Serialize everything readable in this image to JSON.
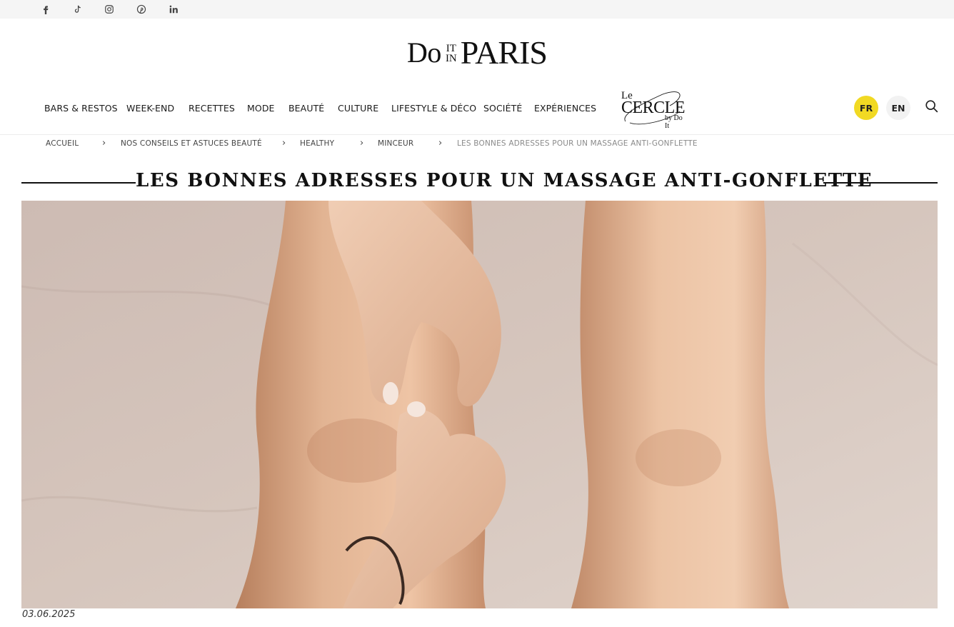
{
  "social": {
    "icons": [
      "facebook-icon",
      "tiktok-icon",
      "instagram-icon",
      "pinterest-icon",
      "linkedin-icon"
    ]
  },
  "logo": {
    "do": "Do",
    "it": "IT",
    "in": "IN",
    "paris": "PARIS"
  },
  "nav": {
    "items": [
      {
        "label": "BARS & RESTOS"
      },
      {
        "label": "WEEK-END"
      },
      {
        "label": "RECETTES"
      },
      {
        "label": "MODE"
      },
      {
        "label": "BEAUTÉ"
      },
      {
        "label": "CULTURE"
      },
      {
        "label": "LIFESTYLE & DÉCO"
      },
      {
        "label": "SOCIÉTÉ"
      },
      {
        "label": "EXPÉRIENCES"
      }
    ],
    "cercle": {
      "le": "Le",
      "cercle": "CERCLE",
      "by": "by Do It"
    },
    "languages": {
      "fr": "FR",
      "en": "EN"
    }
  },
  "breadcrumb": {
    "items": [
      {
        "label": "ACCUEIL"
      },
      {
        "label": "NOS CONSEILS ET ASTUCES BEAUTÉ"
      },
      {
        "label": "HEALTHY"
      },
      {
        "label": "MINCEUR"
      },
      {
        "label": "LES BONNES ADRESSES POUR UN MASSAGE ANTI-GONFLETTE"
      }
    ],
    "separator": "›"
  },
  "article": {
    "title": "LES BONNES ADRESSES POUR UN MASSAGE ANTI-GONFLETTE",
    "date": "03.06.2025"
  },
  "colors": {
    "accent_yellow": "#f1d923",
    "top_bar": "#f5f5f5",
    "text": "#1a1a1a",
    "breadcrumb_current": "#8a8a8a"
  }
}
